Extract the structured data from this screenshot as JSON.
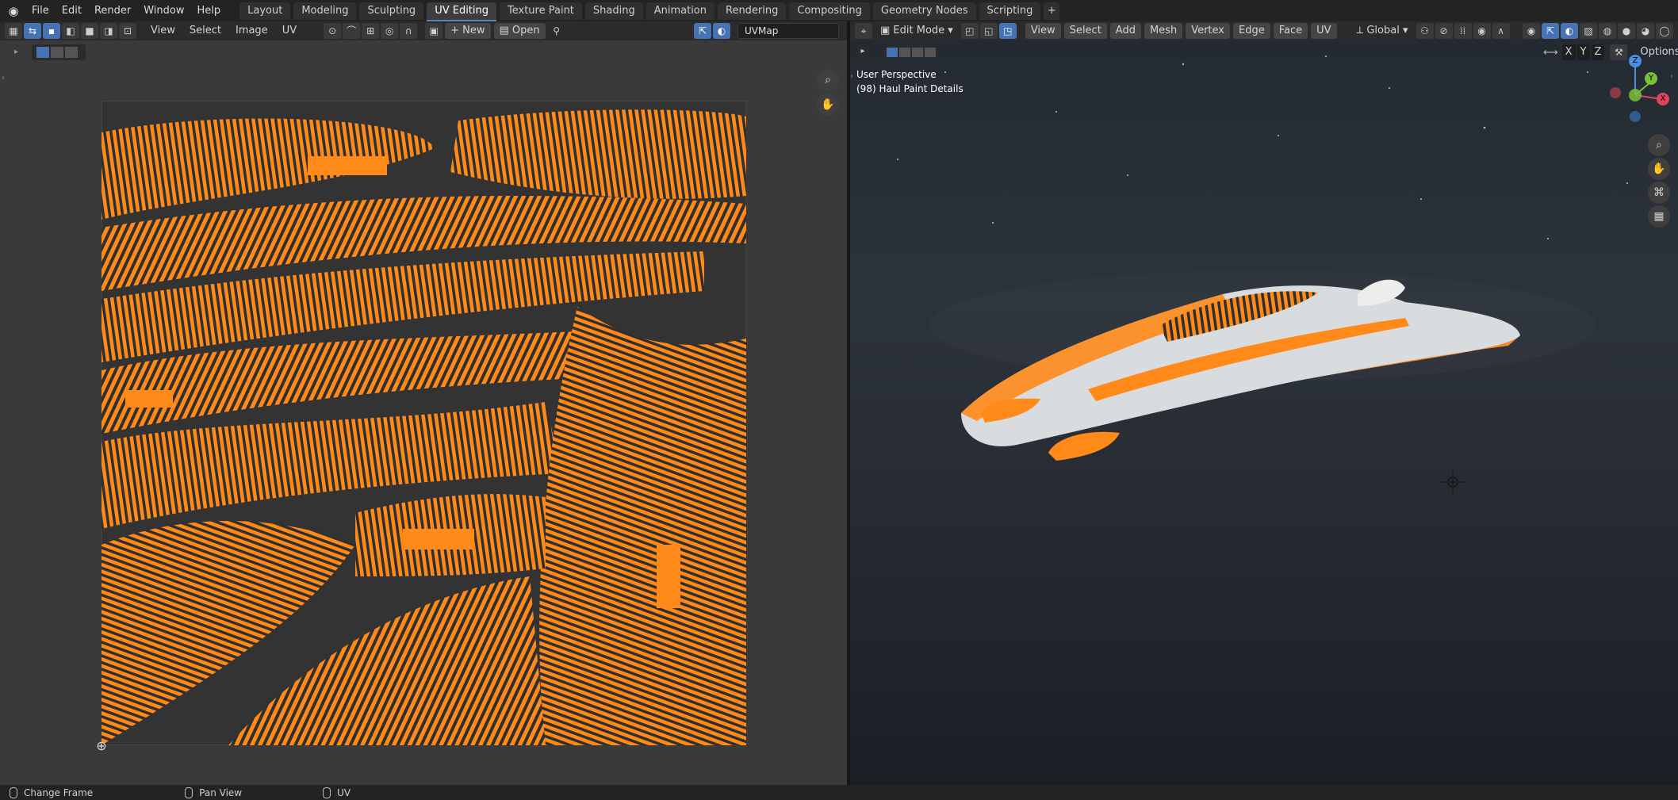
{
  "menu": [
    "File",
    "Edit",
    "Render",
    "Window",
    "Help"
  ],
  "workspace_tabs": [
    {
      "label": "Layout",
      "active": false
    },
    {
      "label": "Modeling",
      "active": false
    },
    {
      "label": "Sculpting",
      "active": false
    },
    {
      "label": "UV Editing",
      "active": true
    },
    {
      "label": "Texture Paint",
      "active": false
    },
    {
      "label": "Shading",
      "active": false
    },
    {
      "label": "Animation",
      "active": false
    },
    {
      "label": "Rendering",
      "active": false
    },
    {
      "label": "Compositing",
      "active": false
    },
    {
      "label": "Geometry Nodes",
      "active": false
    },
    {
      "label": "Scripting",
      "active": false
    }
  ],
  "uv_header": {
    "menus": [
      "View",
      "Select",
      "Image",
      "UV"
    ],
    "new_label": "New",
    "open_label": "Open",
    "uvmap_name": "UVMap"
  },
  "viewport_header": {
    "mode": "Edit Mode",
    "menus": [
      "View",
      "Select",
      "Add",
      "Mesh",
      "Vertex",
      "Edge",
      "Face",
      "UV"
    ],
    "orientation": "Global",
    "axes": [
      "X",
      "Y",
      "Z"
    ],
    "options_label": "Options"
  },
  "viewport_overlay": {
    "perspective": "User Perspective",
    "object_info": "(98) Haul Paint Details"
  },
  "gizmo": {
    "z": "Z",
    "y": "Y",
    "x": "X"
  },
  "statusbar": {
    "left": "Change Frame",
    "middle": "Pan View",
    "right": "UV"
  },
  "colors": {
    "accent": "#4772b3",
    "uv_orange": "#ff8a1a",
    "hull_white": "#d9dcdf"
  }
}
